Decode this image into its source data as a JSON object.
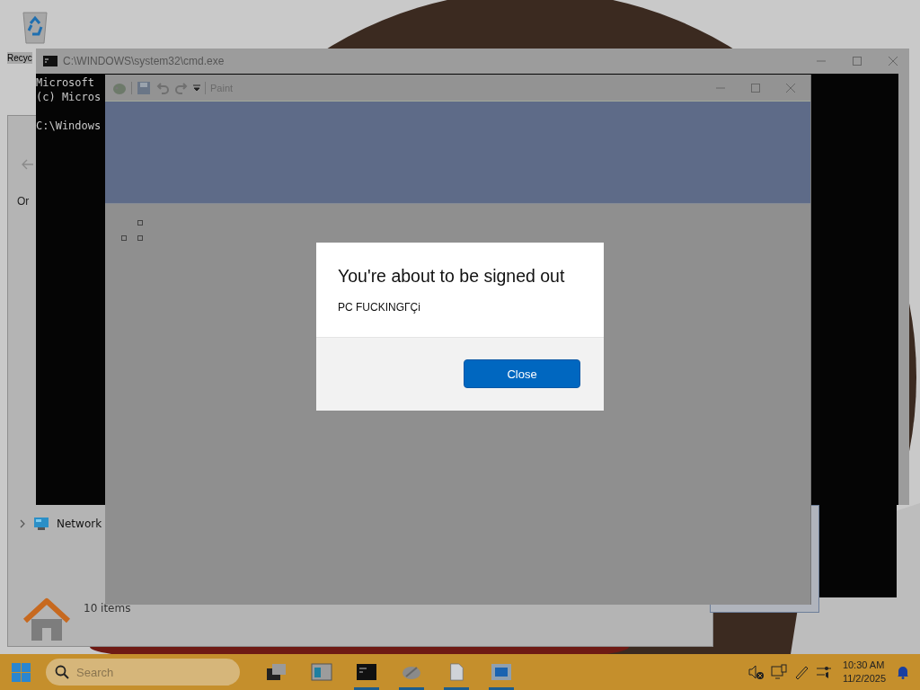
{
  "desktop": {
    "icons": [
      {
        "label": "Recyc"
      }
    ]
  },
  "explorer": {
    "nav_item": "Or",
    "tree": [
      {
        "label": "Network",
        "expanded": false
      }
    ],
    "status": "10 items"
  },
  "cmd": {
    "title": "C:\\WINDOWS\\system32\\cmd.exe",
    "header_lines": [
      "Microsoft",
      "(c) Micros"
    ],
    "prompt": "C:\\Windows"
  },
  "paint": {
    "title": "Paint"
  },
  "dialog": {
    "title": "You're about to be signed out",
    "message": "PC FUCKINGΓÇi",
    "button": "Close"
  },
  "taskbar": {
    "search_placeholder": "Search",
    "apps": [
      {
        "kind": "taskview",
        "running": false
      },
      {
        "kind": "explorer",
        "running": false
      },
      {
        "kind": "cmd",
        "running": true
      },
      {
        "kind": "paint",
        "running": true
      },
      {
        "kind": "notepad",
        "running": true
      },
      {
        "kind": "window",
        "running": true
      }
    ],
    "time": "10:30 AM",
    "date": "11/2/2025"
  }
}
